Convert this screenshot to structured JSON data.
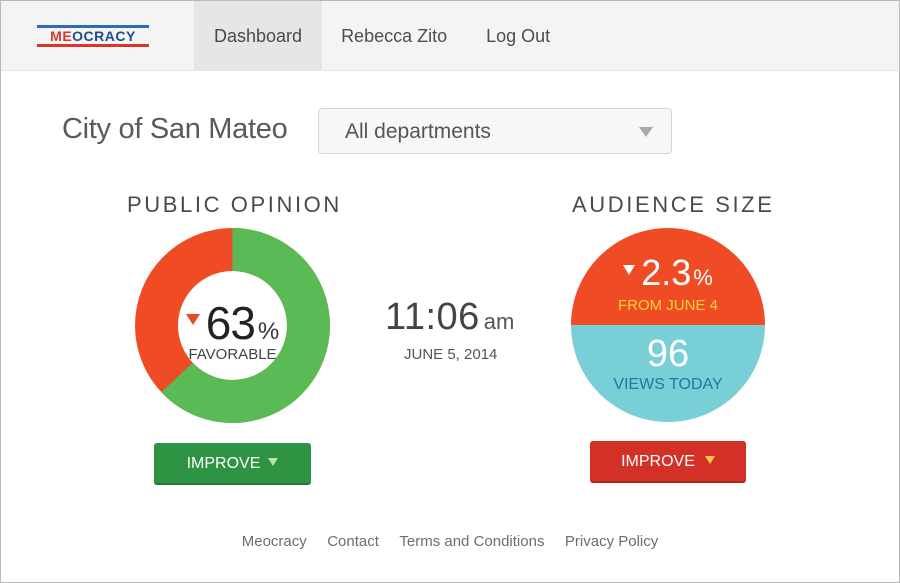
{
  "app": {
    "logo_text_part1": "ME",
    "logo_text_part2": "OCRACY",
    "logo_colors": {
      "blue": "#2b6cb8",
      "red": "#d9362b"
    }
  },
  "nav": {
    "items": [
      {
        "label": "Dashboard",
        "active": true
      },
      {
        "label": "Rebecca Zito",
        "active": false
      },
      {
        "label": "Log Out",
        "active": false
      }
    ]
  },
  "city": {
    "name": "City of San Mateo",
    "department_select": {
      "selected": "All departments"
    }
  },
  "public_opinion": {
    "title": "PUBLIC OPINION",
    "trend": "down",
    "value": "63",
    "unit": "%",
    "label": "FAVORABLE",
    "favorable_fraction": 0.63,
    "colors": {
      "favorable": "#5abb56",
      "unfavorable": "#ef4c26"
    },
    "button_label": "IMPROVE"
  },
  "timestamp": {
    "time": "11:06",
    "ampm": "am",
    "date": "JUNE 5, 2014"
  },
  "audience_size": {
    "title": "AUDIENCE SIZE",
    "trend": "down",
    "change_value": "2.3",
    "change_unit": "%",
    "change_label": "FROM JUNE 4",
    "views": "96",
    "views_label": "VIEWS TODAY",
    "colors": {
      "top": "#ef4c26",
      "bottom": "#78d0d6"
    },
    "button_label": "IMPROVE"
  },
  "footer": {
    "links": [
      "Meocracy",
      "Contact",
      "Terms and Conditions",
      "Privacy Policy"
    ]
  }
}
